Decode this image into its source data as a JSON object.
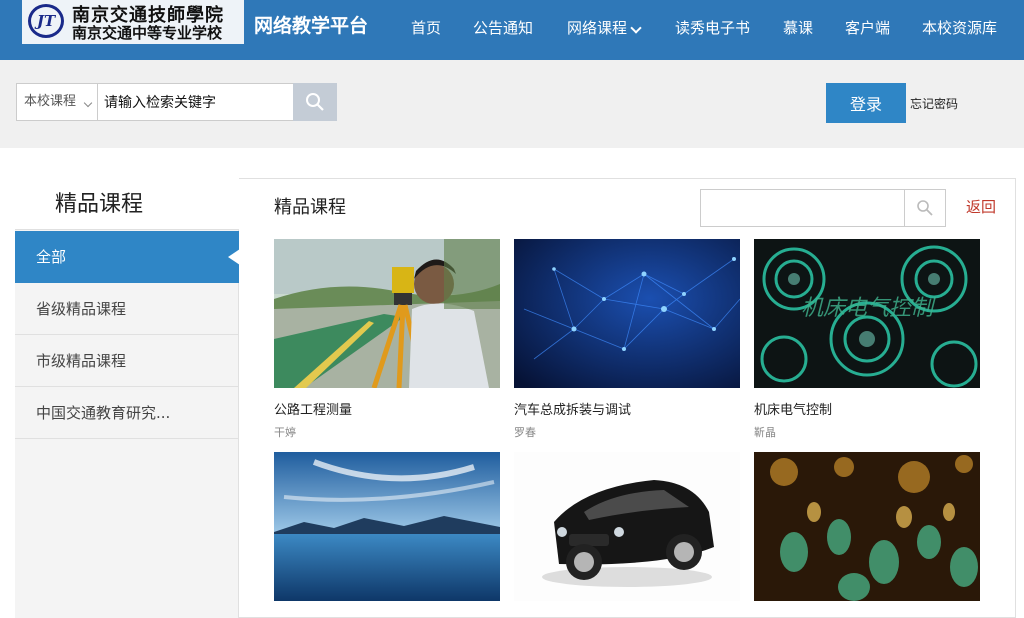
{
  "header": {
    "logo_line1": "南京交通技師學院",
    "logo_line2": "南京交通中等专业学校",
    "logo_mark": "JT",
    "platform_title": "网络教学平台",
    "nav": [
      {
        "label": "首页"
      },
      {
        "label": "公告通知"
      },
      {
        "label": "网络课程"
      },
      {
        "label": "读秀电子书"
      },
      {
        "label": "慕课"
      },
      {
        "label": "客户端"
      },
      {
        "label": "本校资源库"
      }
    ]
  },
  "search": {
    "scope": "本校课程",
    "value": "请输入检索关键字",
    "icon": "search-icon"
  },
  "account": {
    "login_label": "登录",
    "forgot_label": "忘记密码"
  },
  "sidebar": {
    "title": "精品课程",
    "items": [
      {
        "label": "全部",
        "active": true
      },
      {
        "label": "省级精品课程"
      },
      {
        "label": "市级精品课程"
      },
      {
        "label": "中国交通教育研究..."
      }
    ]
  },
  "main": {
    "title": "精品课程",
    "filter_value": "",
    "back_label": "返回",
    "courses": [
      {
        "title": "公路工程测量",
        "teacher": "干婷"
      },
      {
        "title": "汽车总成拆装与调试",
        "teacher": "罗春"
      },
      {
        "title": "机床电气控制",
        "teacher": "靳晶",
        "thumb_text": "机床电气控制"
      },
      {
        "title": "",
        "teacher": ""
      },
      {
        "title": "",
        "teacher": ""
      },
      {
        "title": "",
        "teacher": ""
      }
    ]
  },
  "colors": {
    "header_blue": "#2f78b8",
    "accent_blue": "#2f86c6",
    "back_red": "#c0392b"
  }
}
